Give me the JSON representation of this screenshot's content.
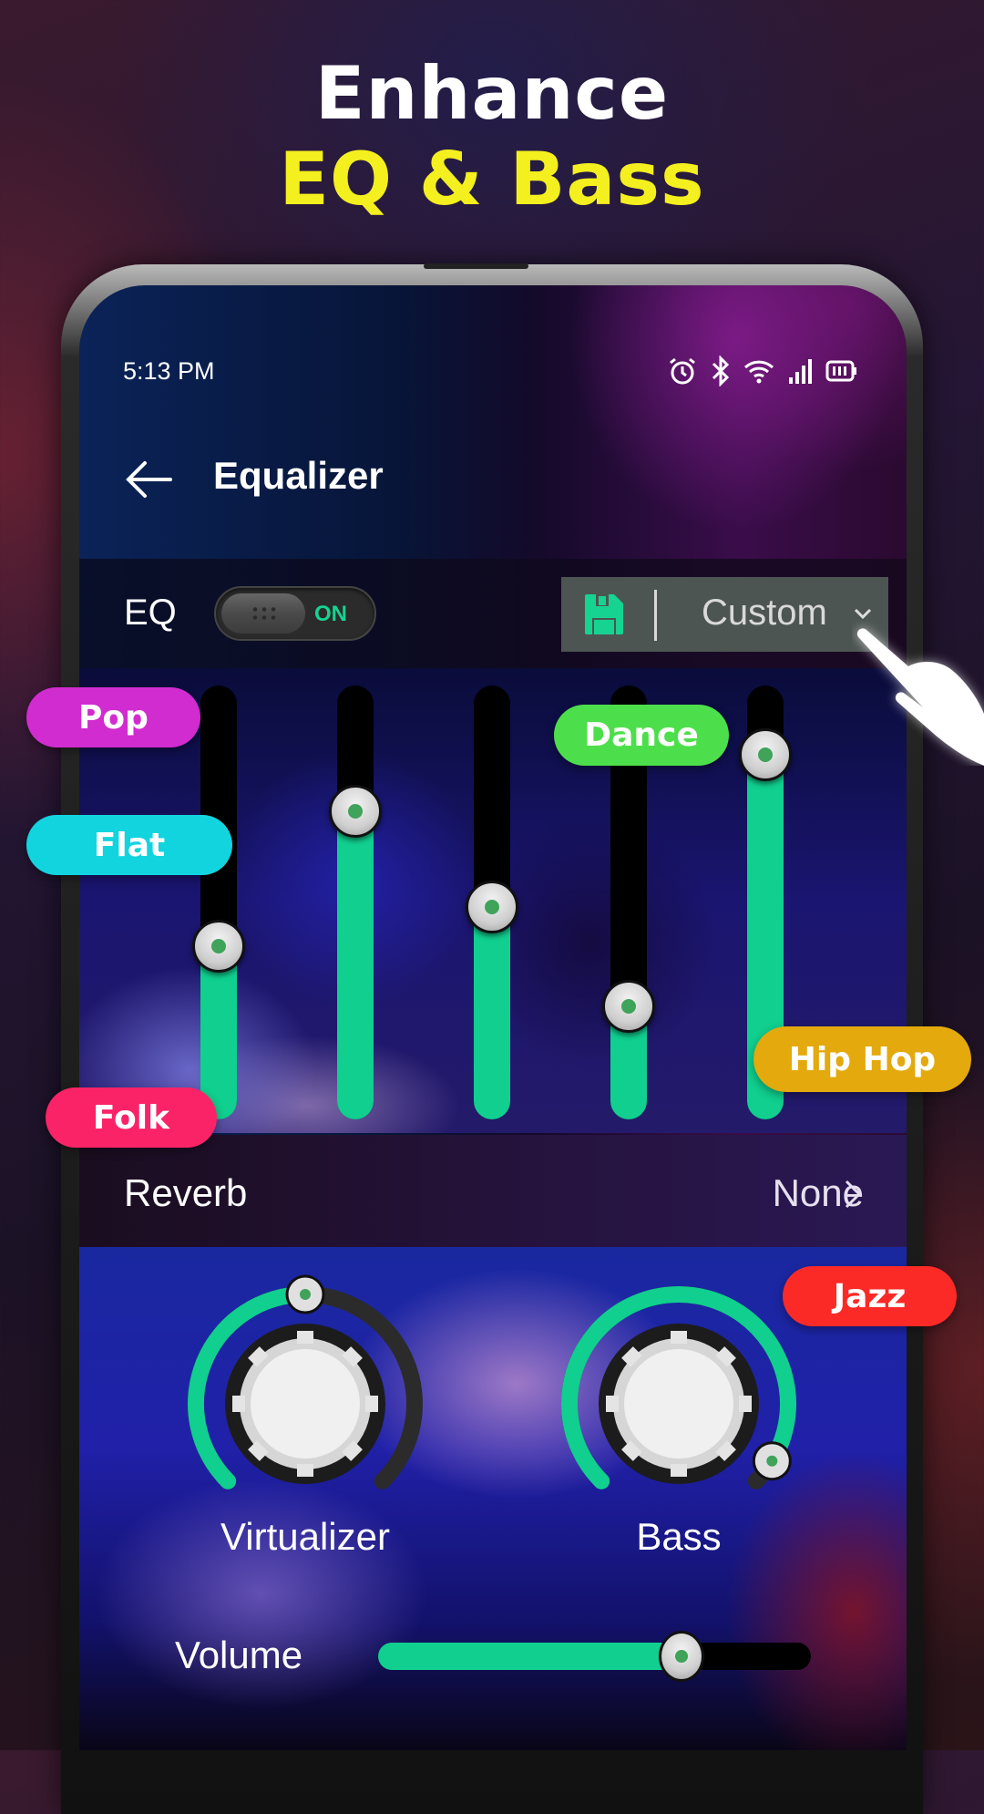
{
  "promo": {
    "line1": "Enhance",
    "line2": "EQ & Bass",
    "line1_color": "#ffffff",
    "line2_color": "#f4ef1e"
  },
  "status_bar": {
    "time": "5:13 PM",
    "icons": [
      "alarm-icon",
      "bluetooth-icon",
      "wifi-icon",
      "signal-icon",
      "battery-icon"
    ]
  },
  "header": {
    "title": "Equalizer",
    "back_icon": "arrow-left-icon"
  },
  "eq": {
    "label": "EQ",
    "toggle": {
      "state": "ON",
      "on": true
    },
    "preset": {
      "value": "Custom",
      "save_icon": "save-icon",
      "chevron_icon": "chevron-down-icon"
    },
    "bands": [
      {
        "level": 0.4
      },
      {
        "level": 0.71
      },
      {
        "level": 0.49
      },
      {
        "level": 0.26
      },
      {
        "level": 0.84
      }
    ]
  },
  "preset_chips": [
    {
      "label": "Pop",
      "color": "#d12ccf"
    },
    {
      "label": "Flat",
      "color": "#12d4df"
    },
    {
      "label": "Folk",
      "color": "#fb2368"
    },
    {
      "label": "Dance",
      "color": "#4ddf4b"
    },
    {
      "label": "Hip Hop",
      "color": "#e3a90d"
    },
    {
      "label": "Jazz",
      "color": "#fb2a26"
    }
  ],
  "reverb": {
    "label": "Reverb",
    "value": "None"
  },
  "effects": {
    "virtualizer": {
      "label": "Virtualizer",
      "level": 0.5
    },
    "bass": {
      "label": "Bass",
      "level": 0.95
    }
  },
  "volume": {
    "label": "Volume",
    "level": 0.7
  },
  "accent_color": "#10cf8f"
}
